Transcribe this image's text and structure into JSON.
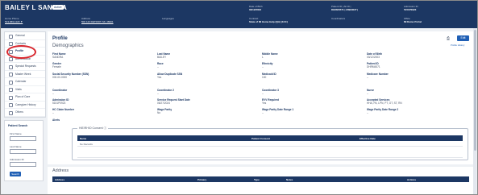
{
  "header": {
    "name": "BAILEY L SANDRA",
    "status": "Active",
    "fields": [
      {
        "label": "Home Phone",
        "value": "513-969-1120 ▼",
        "kind": "link"
      },
      {
        "label": "Address",
        "value": "500 123 DETROIT, MI, 48201",
        "kind": "link"
      },
      {
        "label": "Languages",
        "value": "",
        "kind": "val"
      },
      {
        "label": "Date of Birth",
        "value": "03/12/2003",
        "kind": "val"
      },
      {
        "label": "Patient ID | Alt ID |",
        "value": "DHRM4571 | 20994027 |",
        "kind": "val"
      },
      {
        "label": "Admission ID",
        "value": "5151P0923",
        "kind": "val"
      },
      {
        "label": "Contract",
        "value": "State of MI Home Help (QA) (1CC)",
        "kind": "val"
      },
      {
        "label": "Coordinators",
        "value": "",
        "kind": "val"
      },
      {
        "label": "Office",
        "value": "MI Demo Portal",
        "kind": "val"
      }
    ]
  },
  "sidebar": {
    "items": [
      "General",
      "Contacts",
      "Profile",
      "Authorization",
      "Special Requests",
      "Master Week",
      "Calendar",
      "Visits",
      "Plan of Care",
      "Caregiver History",
      "Others"
    ],
    "active": "Profile",
    "search": {
      "title": "Patient Search",
      "first_name": "First Name",
      "last_name": "Last Name",
      "admission_id": "Admission ID",
      "button": "Search"
    }
  },
  "profile": {
    "title": "Profile",
    "subtitle": "Demographics",
    "edit_label": "Edit",
    "history_label": "Profile History",
    "fields": [
      {
        "label": "First Name",
        "value": "SANDRA"
      },
      {
        "label": "Last Name",
        "value": "BAILEY"
      },
      {
        "label": "Middle Name",
        "value": "L"
      },
      {
        "label": "Date of Birth",
        "value": "03/12/2003"
      },
      {
        "label": "Gender",
        "value": "Female"
      },
      {
        "label": "Race",
        "value": "--"
      },
      {
        "label": "Ethnicity",
        "value": "--"
      },
      {
        "label": "Patient ID",
        "value": "DHRM4571"
      },
      {
        "label": "Social Security Number (SSN)",
        "value": "000-00-0000"
      },
      {
        "label": "Allow Duplicate SSN",
        "value": "Yes"
      },
      {
        "label": "Medicaid ID",
        "value": "100"
      },
      {
        "label": "Medicare Number",
        "value": "--"
      },
      {
        "label": "Coordinator",
        "value": "--"
      },
      {
        "label": "Coordinator 2",
        "value": "--"
      },
      {
        "label": "Coordinator 3",
        "value": "--"
      },
      {
        "label": "Nurse",
        "value": "--"
      },
      {
        "label": "Admission ID",
        "value": "5151P0923"
      },
      {
        "label": "Service Request Start Date",
        "value": "06/27/2024"
      },
      {
        "label": "EVV Required",
        "value": "Yes"
      },
      {
        "label": "Accepted Services",
        "value": "HHA, PA, LPN, PT, OT, ST, RN"
      },
      {
        "label": "HC Claim Number",
        "value": "--"
      },
      {
        "label": "Wage Parity",
        "value": "No"
      },
      {
        "label": "Wage Parity Date Range 1",
        "value": "--"
      },
      {
        "label": "Wage Parity Date Range 2",
        "value": "--"
      },
      {
        "label": "Alerts",
        "value": ""
      }
    ],
    "hie_history": {
      "caption": "HIE/RHIO Consent",
      "columns": [
        "Name",
        "Patient Consent",
        "Effective Date"
      ],
      "empty": "No Records"
    }
  },
  "address": {
    "title": "Address",
    "columns": [
      "Address",
      "Primary",
      "Type",
      "Notes",
      "Actions"
    ]
  }
}
